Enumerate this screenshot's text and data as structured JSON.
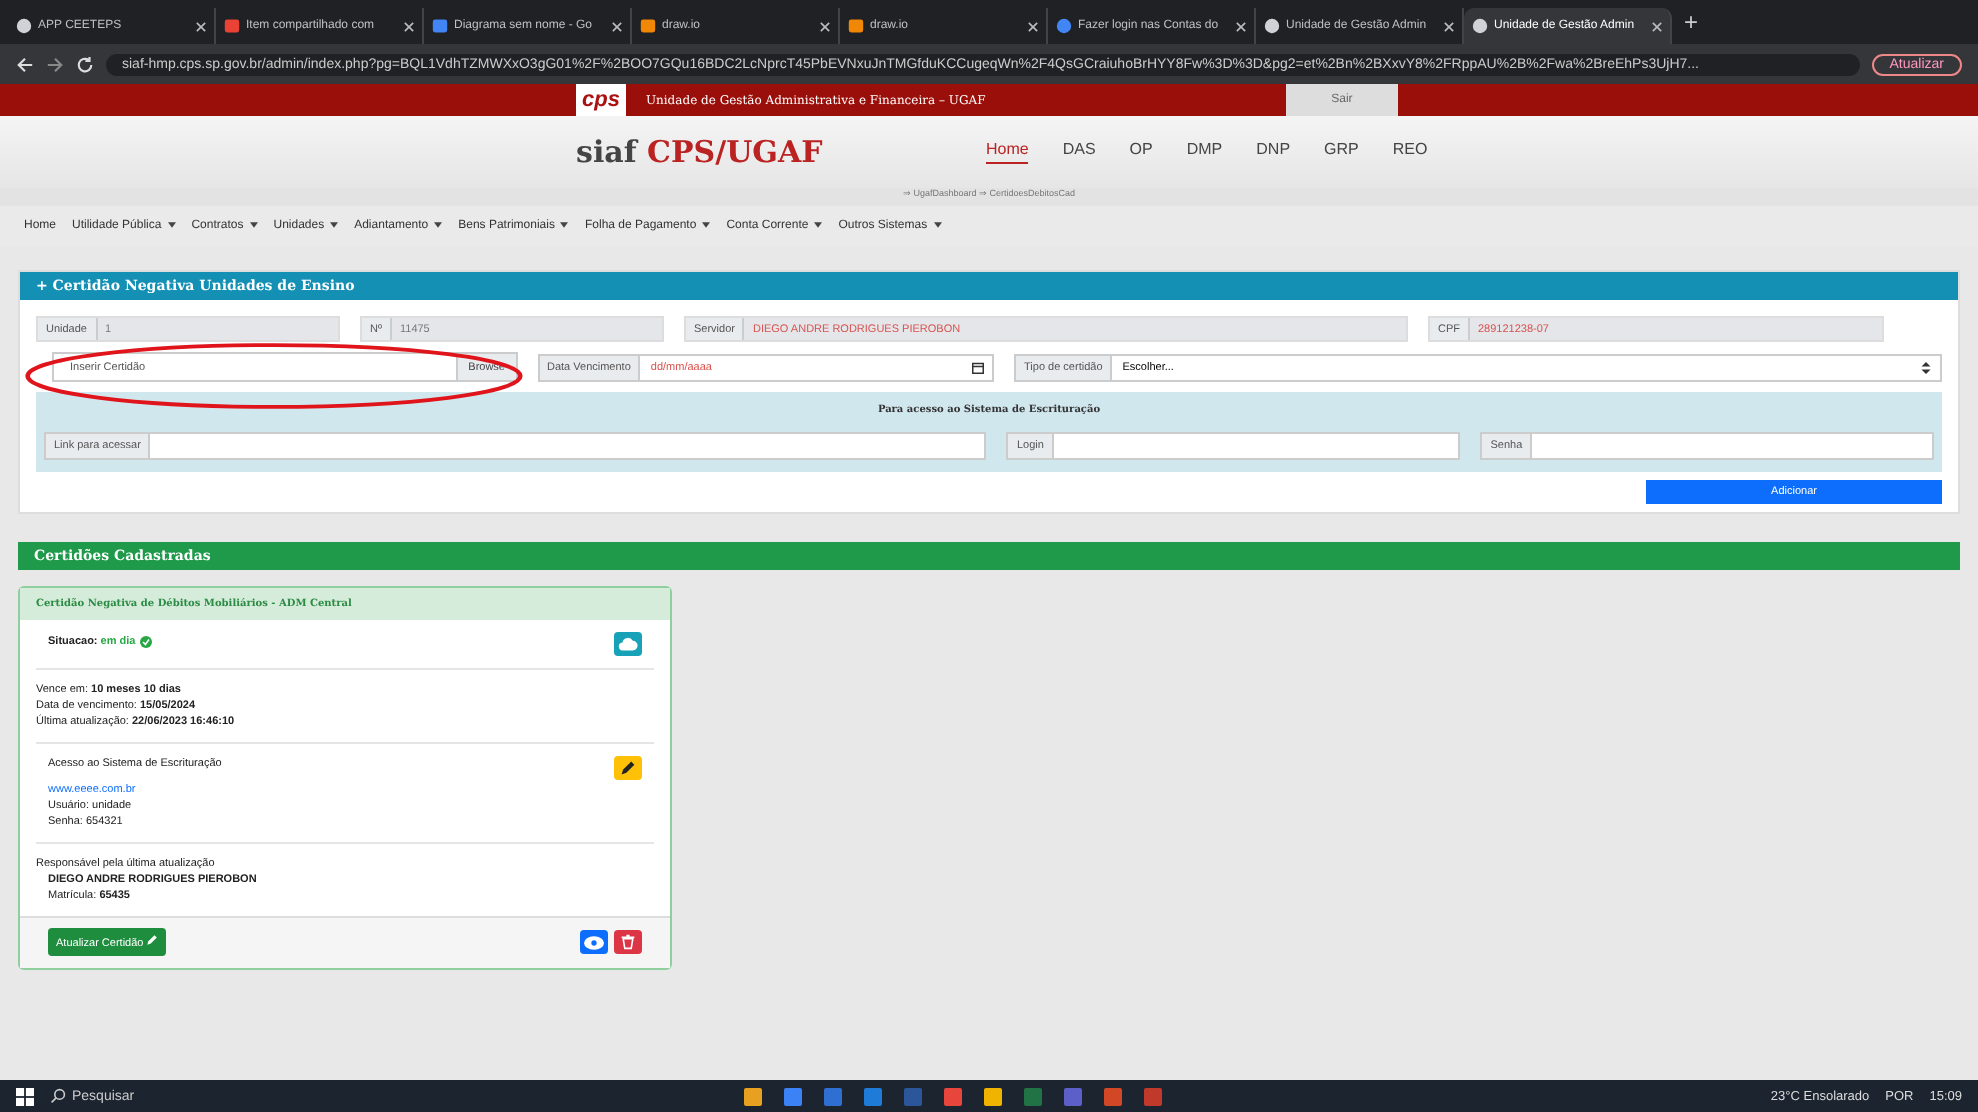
{
  "browser": {
    "tabs": [
      {
        "label": "APP CEETEPS",
        "selected": false
      },
      {
        "label": "Item compartilhado com",
        "selected": false
      },
      {
        "label": "Diagrama sem nome - Go",
        "selected": false
      },
      {
        "label": "draw.io",
        "selected": false
      },
      {
        "label": "draw.io",
        "selected": false
      },
      {
        "label": "Fazer login nas Contas do",
        "selected": false
      },
      {
        "label": "Unidade de Gestão Admin",
        "selected": false
      },
      {
        "label": "Unidade de Gestão Admin",
        "selected": true
      }
    ],
    "new_tab": "+",
    "url": "siaf-hmp.cps.sp.gov.br/admin/index.php?pg=BQL1VdhTZMWXxO3gG01%2F%2BOO7GQu16BDC2LcNprcT45PbEVNxuJnTMGfduKCCugeqWn%2F4QsGCraiuhoBrHYY8Fw%3D%3D&pg2=et%2Bn%2BXxvY8%2FRppAU%2B%2Fwa%2BreEhPs3UjH7...",
    "update_button": "Atualizar"
  },
  "topbar": {
    "logo": "cps",
    "title": "Unidade de Gestão Administrativa e Financeira – UGAF",
    "logout": "Sair"
  },
  "header": {
    "brand": "siaf",
    "brand_accent": "CPS/UGAF",
    "nav": [
      {
        "label": "Home",
        "selected": true
      },
      {
        "label": "DAS",
        "selected": false
      },
      {
        "label": "OP",
        "selected": false
      },
      {
        "label": "DMP",
        "selected": false
      },
      {
        "label": "DNP",
        "selected": false
      },
      {
        "label": "GRP",
        "selected": false
      },
      {
        "label": "REO",
        "selected": false
      }
    ],
    "breadcrumb": "⇒ UgafDashboard ⇒ CertidoesDebitosCad"
  },
  "menu": [
    {
      "label": "Home",
      "dropdown": false
    },
    {
      "label": "Utilidade Pública",
      "dropdown": true
    },
    {
      "label": "Contratos",
      "dropdown": true
    },
    {
      "label": "Unidades",
      "dropdown": true
    },
    {
      "label": "Adiantamento",
      "dropdown": true
    },
    {
      "label": "Bens Patrimoniais",
      "dropdown": true
    },
    {
      "label": "Folha de Pagamento",
      "dropdown": true
    },
    {
      "label": "Conta Corrente",
      "dropdown": true
    },
    {
      "label": "Outros Sistemas",
      "dropdown": true
    }
  ],
  "form": {
    "title": "+ Certidão Negativa Unidades de Ensino",
    "row1": [
      {
        "label": "Unidade",
        "value": "1"
      },
      {
        "label": "Nº",
        "value": "11475"
      },
      {
        "label": "Servidor",
        "value": "DIEGO ANDRE RODRIGUES PIEROBON"
      },
      {
        "label": "CPF",
        "value": "289121238-07"
      }
    ],
    "file": {
      "placeholder": "Inserir Certidão",
      "button": "Browse"
    },
    "date": {
      "label": "Data Vencimento",
      "placeholder": "dd/mm/aaaa"
    },
    "type": {
      "label": "Tipo de certidão",
      "value": "Escolher..."
    },
    "access": {
      "title": "Para acesso ao Sistema de Escrituração",
      "fields": [
        {
          "label": "Link para acessar"
        },
        {
          "label": "Login"
        },
        {
          "label": "Senha"
        }
      ]
    },
    "submit": "Adicionar"
  },
  "list": {
    "title": "Certidões Cadastradas",
    "card": {
      "title": "Certidão Negativa de Débitos Mobiliários - ADM Central",
      "status_label": "Situacao:",
      "status": "em dia",
      "ok": true,
      "lines": [
        {
          "label": "Vence em:",
          "value": "10 meses 10 dias"
        },
        {
          "label": "Data de vencimento:",
          "value": "15/05/2024"
        },
        {
          "label": "Última atualização:",
          "value": "22/06/2023 16:46:10"
        }
      ],
      "access_title": "Acesso ao Sistema de Escrituração",
      "link": "www.eeee.com.br",
      "user": "Usuário: unidade",
      "password": "Senha: 654321",
      "resp_title": "Responsável pela última atualização",
      "resp_name": "DIEGO ANDRE RODRIGUES PIEROBON",
      "resp_id_label": "Matrícula:",
      "resp_id": "65435",
      "update_button": "Atualizar Certidão"
    }
  },
  "taskbar": {
    "search": "Pesquisar",
    "weather": "23°C Ensolarado",
    "lang": "POR",
    "time": "15:09"
  }
}
